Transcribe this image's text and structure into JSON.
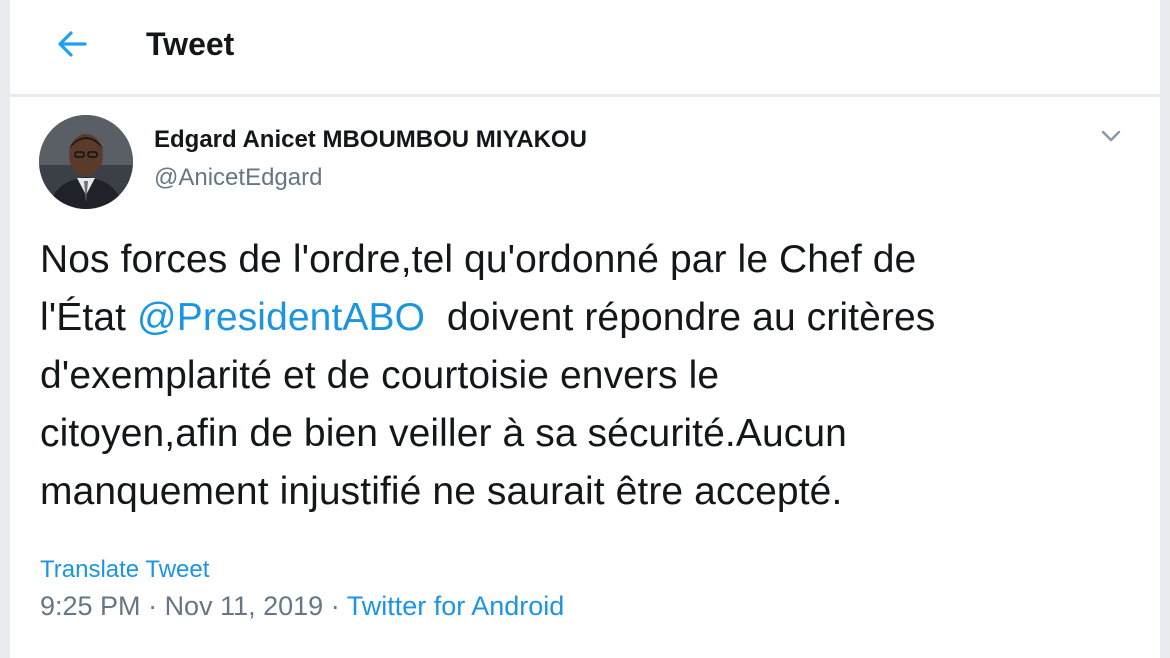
{
  "header": {
    "title": "Tweet",
    "back_icon": "arrow-left-icon"
  },
  "tweet": {
    "author": {
      "name": "Edgard Anicet MBOUMBOU MIYAKOU",
      "handle": "@AnicetEdgard"
    },
    "menu_icon": "chevron-down-icon",
    "text": {
      "line1": "Nos forces de l'ordre,tel qu'ordonné par le Chef de",
      "line2_pre": "l'État ",
      "mention": "@PresidentABO",
      "line2_post": "  doivent répondre au critères",
      "line3": "d'exemplarité et de courtoisie envers le",
      "line4": "citoyen,afin de bien veiller à sa sécurité.Aucun",
      "line5": "manquement injustifié ne saurait être accepté."
    },
    "translate_label": "Translate Tweet",
    "time": "9:25 PM",
    "separator": " · ",
    "date": "Nov 11, 2019",
    "source": "Twitter for Android"
  },
  "colors": {
    "accent": "#1b95e0",
    "secondary_text": "#657786",
    "primary_text": "#14171a"
  }
}
